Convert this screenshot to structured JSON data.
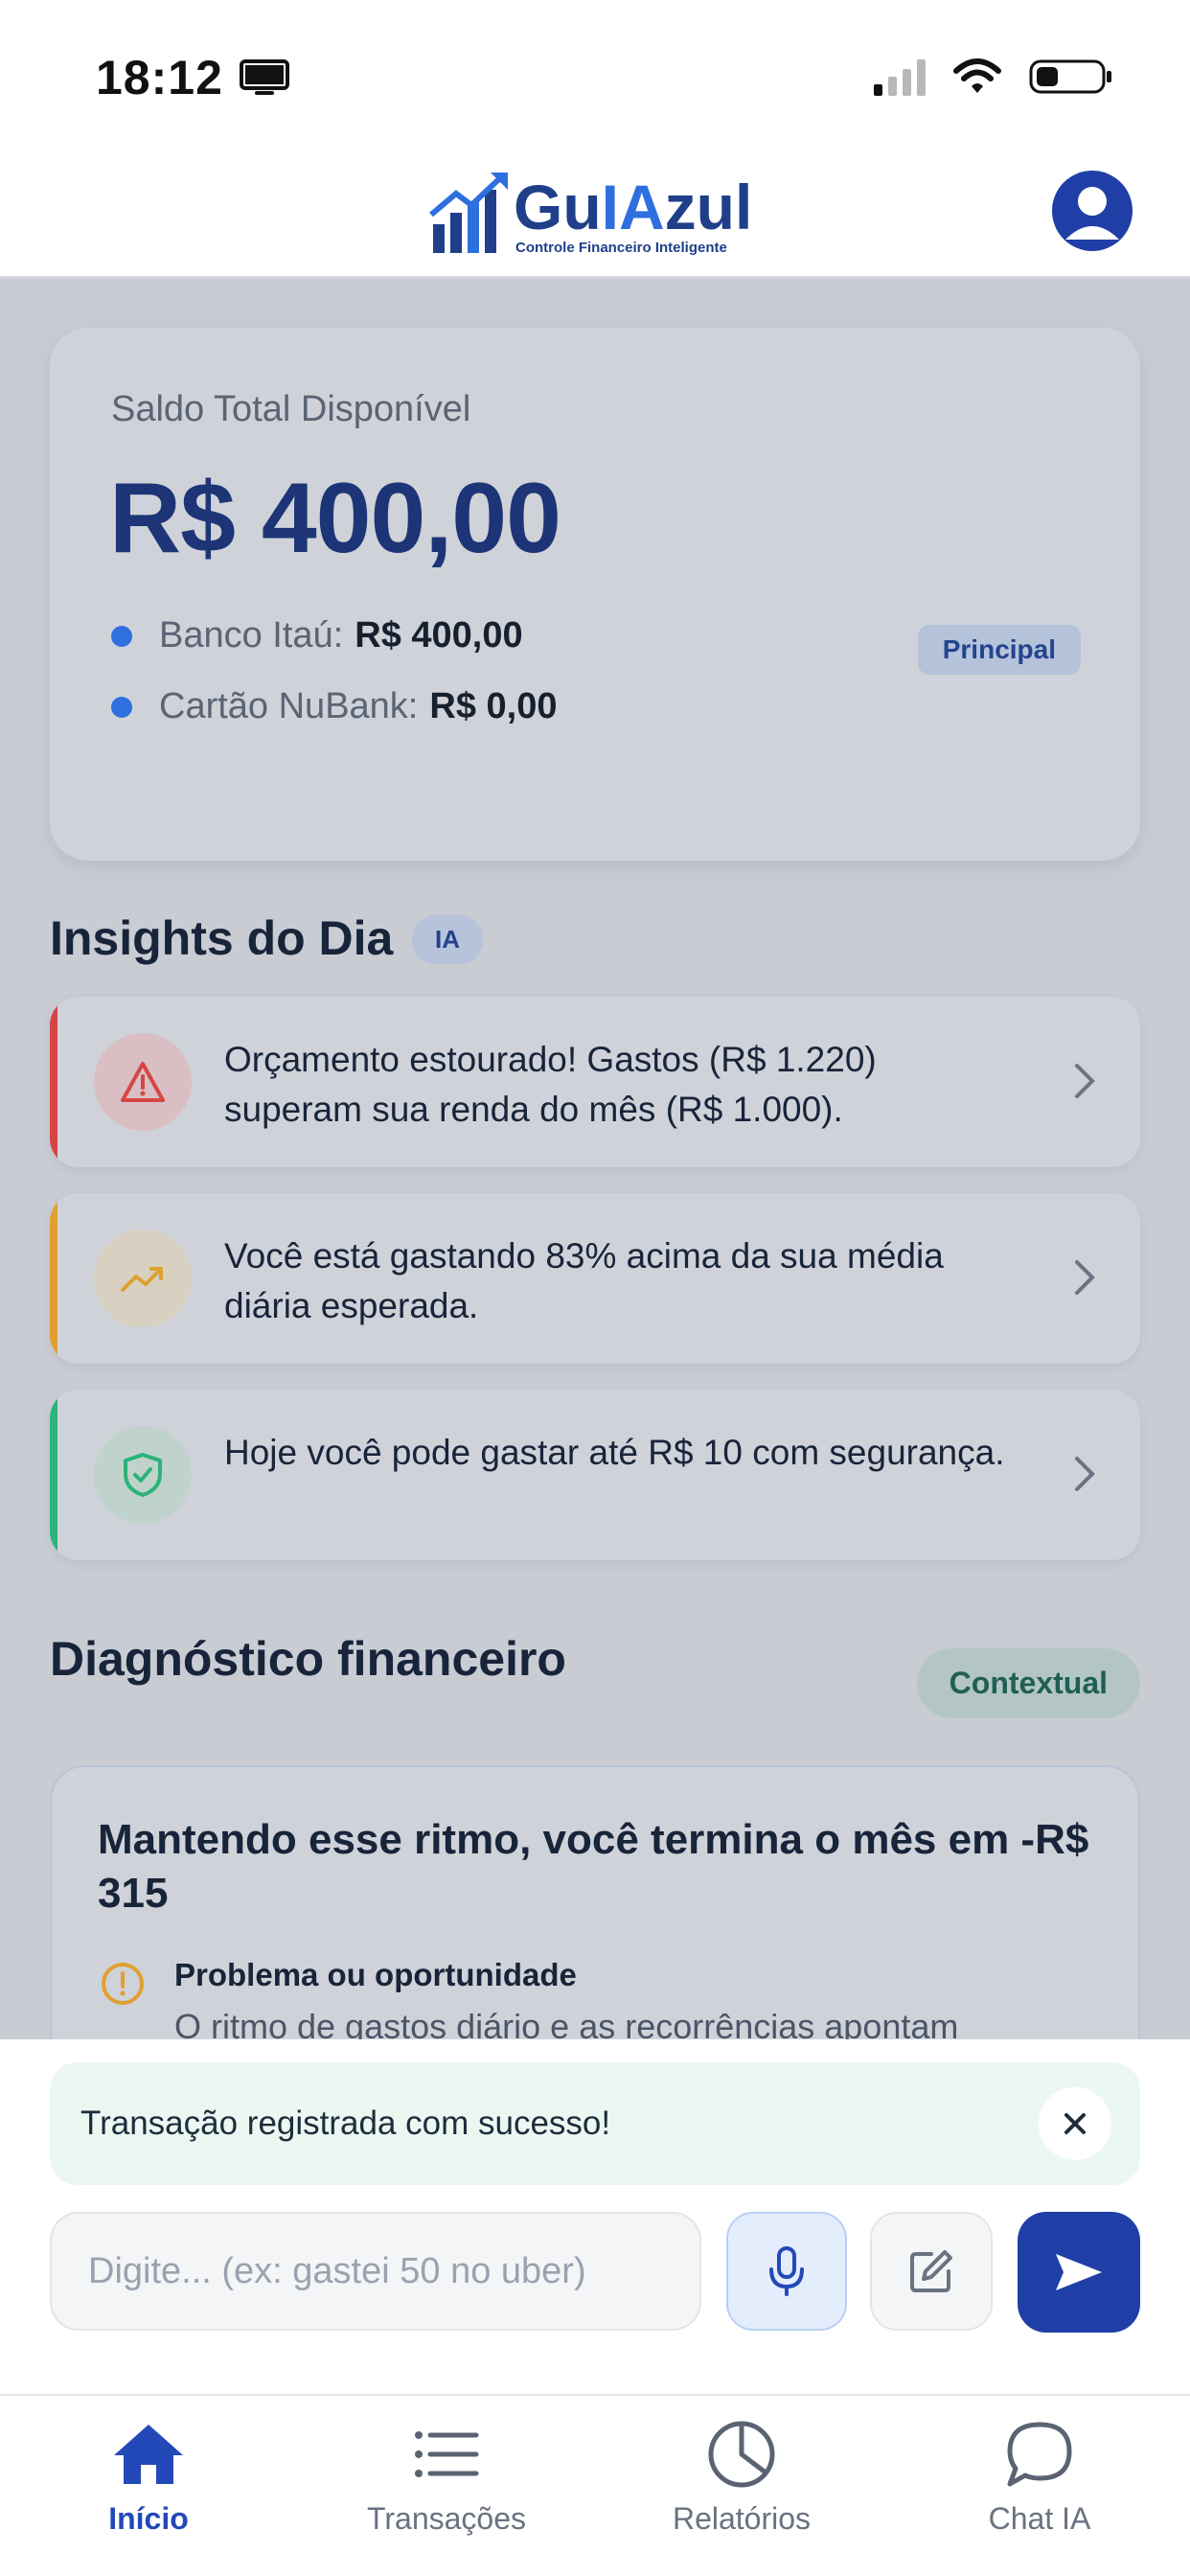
{
  "status_bar": {
    "time": "18:12"
  },
  "header": {
    "logo_main": "Gu",
    "logo_ia": "IA",
    "logo_end": "zul",
    "logo_subtitle": "Controle Financeiro Inteligente"
  },
  "balance": {
    "label": "Saldo Total Disponível",
    "amount": "R$ 400,00",
    "accounts": [
      {
        "name": "Banco Itaú:",
        "value": "R$ 400,00",
        "badge": "Principal"
      },
      {
        "name": "Cartão NuBank:",
        "value": "R$ 0,00"
      }
    ]
  },
  "insights": {
    "title": "Insights do Dia",
    "badge": "IA",
    "items": [
      {
        "text": "Orçamento estourado! Gastos (R$ 1.220) superam sua renda do mês (R$ 1.000).",
        "icon": "warning-triangle-icon",
        "color": "#d64545"
      },
      {
        "text": "Você está gastando 83% acima da sua média diária esperada.",
        "icon": "trend-up-icon",
        "color": "#e0a030"
      },
      {
        "text": "Hoje você pode gastar até R$ 10 com segurança.",
        "icon": "shield-check-icon",
        "color": "#2bb37a"
      }
    ]
  },
  "diagnostic": {
    "title": "Diagnóstico financeiro",
    "badge": "Contextual",
    "card_title": "Mantendo esse ritmo, você termina o mês em -R$ 315",
    "subtitle": "Problema ou oportunidade",
    "text": "O ritmo de gastos diário e as recorrências apontam"
  },
  "toast": {
    "message": "Transação registrada com sucesso!"
  },
  "composer": {
    "placeholder": "Digite... (ex: gastei 50 no uber)"
  },
  "tabs": [
    {
      "label": "Início",
      "icon": "home-icon",
      "active": true
    },
    {
      "label": "Transações",
      "icon": "list-icon",
      "active": false
    },
    {
      "label": "Relatórios",
      "icon": "pie-chart-icon",
      "active": false
    },
    {
      "label": "Chat IA",
      "icon": "chat-bubble-icon",
      "active": false
    }
  ],
  "colors": {
    "primary": "#1f3fa6",
    "accent": "#2e6fe0"
  }
}
